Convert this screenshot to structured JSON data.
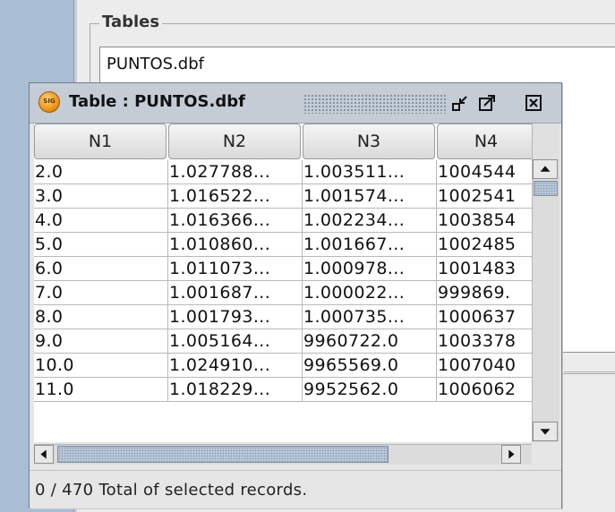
{
  "background_window": {
    "group_title": "Tables",
    "tables": [
      "PUNTOS.dbf"
    ]
  },
  "frame": {
    "title": "Table : PUNTOS.dbf",
    "icon_text": "SIG",
    "icons": {
      "app": "gvsig-logo-icon",
      "minimize": "minimize-icon",
      "maximize": "maximize-icon",
      "close": "close-icon"
    }
  },
  "table": {
    "columns": [
      "N1",
      "N2",
      "N3",
      "N4"
    ],
    "rows": [
      [
        "2.0",
        "1.027788...",
        "1.003511...",
        "1004544"
      ],
      [
        "3.0",
        "1.016522...",
        "1.001574...",
        "1002541"
      ],
      [
        "4.0",
        "1.016366...",
        "1.002234...",
        "1003854"
      ],
      [
        "5.0",
        "1.010860...",
        "1.001667...",
        "1002485"
      ],
      [
        "6.0",
        "1.011073...",
        "1.000978...",
        "1001483"
      ],
      [
        "7.0",
        "1.001687...",
        "1.000022...",
        "999869."
      ],
      [
        "8.0",
        "1.001793...",
        "1.000735...",
        "1000637"
      ],
      [
        "9.0",
        "1.005164...",
        "9960722.0",
        "1003378"
      ],
      [
        "10.0",
        "1.024910...",
        "9965569.0",
        "1007040"
      ],
      [
        "11.0",
        "1.018229...",
        "9952562.0",
        "1006062"
      ]
    ]
  },
  "status": {
    "text": "0 / 470 Total of selected records."
  }
}
